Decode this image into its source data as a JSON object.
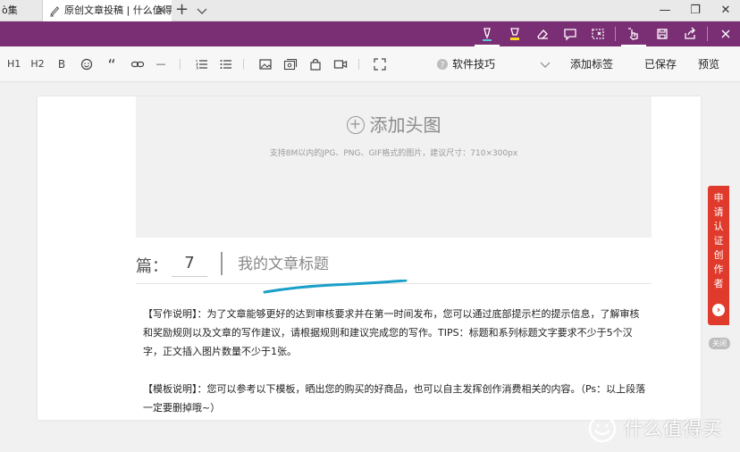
{
  "browser": {
    "prev_tab_label": "ò集",
    "active_tab_title": "原创文章投稿 | 什么值得",
    "tab_close": "✕",
    "new_tab": "+",
    "window_minimize": "—",
    "window_restore": "❐",
    "window_close": "✕"
  },
  "edge_toolbar": {
    "icons": [
      "pen-icon",
      "highlighter-icon",
      "eraser-icon",
      "comment-icon",
      "clip-icon",
      "touch-icon",
      "save-icon",
      "share-icon",
      "exit-icon"
    ],
    "active": "pen-icon"
  },
  "editor_toolbar": {
    "h1": "H1",
    "h2": "H2",
    "bold": "B",
    "quote": "“",
    "hr": "—",
    "category_placeholder": "软件技巧",
    "add_tag": "添加标签",
    "saved": "已保存",
    "preview": "预览"
  },
  "header_image": {
    "add_label": "添加头图",
    "hint": "支持8M以内的JPG、PNG、GIF格式的图片，建议尺寸：710×300px"
  },
  "title_row": {
    "pian_label": "篇：",
    "chapter_number": "7",
    "title_placeholder": "我的文章标题"
  },
  "body": {
    "paragraph_1": "【写作说明】：为了文章能够更好的达到审核要求并在第一时间发布，您可以通过底部提示栏的提示信息，了解审核和奖励规则以及文章的写作建议，请根据规则和建议完成您的写作。TIPS：标题和系列标题文字要求不少于5个汉字，正文插入图片数量不少于1张。",
    "paragraph_2": "【模板说明】：您可以参考以下模板，晒出您的购买的好商品，也可以自主发挥创作消费相关的内容。（Ps：以上段落一定要删掉哦~）"
  },
  "side_badge": {
    "label": "申请认证创作者",
    "arrow": "›",
    "close": "关闭"
  },
  "watermark": {
    "text": "什么值得买"
  },
  "colors": {
    "edge_purple": "#7a2e73",
    "ink_blue": "#1aa0c8",
    "badge_red": "#e03a2c"
  }
}
